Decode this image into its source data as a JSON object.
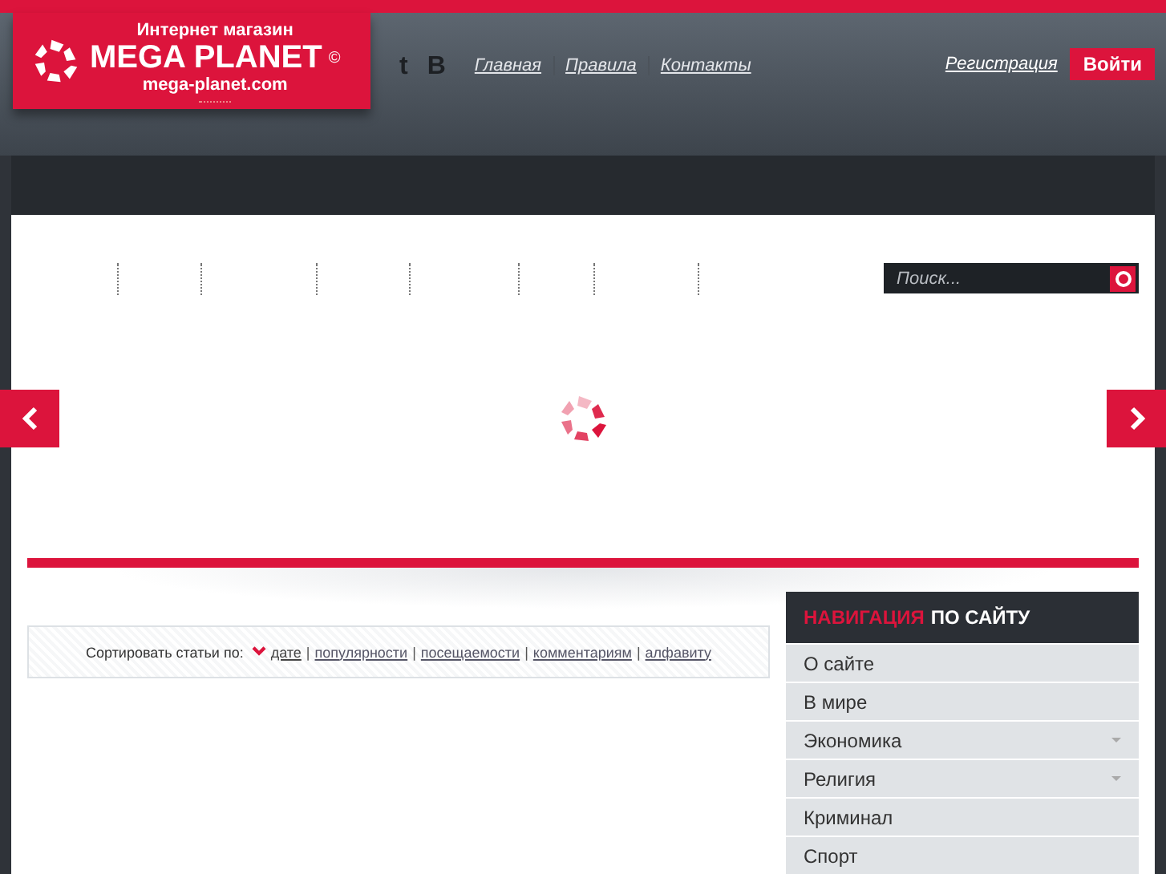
{
  "logo": {
    "tagline": "Интернет магазин",
    "name": "MEGA PLANET",
    "mark": "©",
    "domain": "mega-planet.com"
  },
  "social_icons": [
    "t",
    "B"
  ],
  "top_links": [
    "Главная",
    "Правила",
    "Контакты"
  ],
  "account": {
    "register": "Регистрация",
    "login": "Войти"
  },
  "search": {
    "placeholder": "Поиск..."
  },
  "sort": {
    "label": "Сортировать статьи по:",
    "separator": "|",
    "options": [
      {
        "label": "дате",
        "selected": true
      },
      {
        "label": "популярности",
        "selected": false
      },
      {
        "label": "посещаемости",
        "selected": false
      },
      {
        "label": "комментариям",
        "selected": false
      },
      {
        "label": "алфавиту",
        "selected": false
      }
    ]
  },
  "sidebar": {
    "title_accent": "НАВИГАЦИЯ",
    "title_rest": "ПО САЙТУ",
    "items": [
      {
        "label": "О сайте",
        "expandable": false
      },
      {
        "label": "В мире",
        "expandable": false
      },
      {
        "label": "Экономика",
        "expandable": true
      },
      {
        "label": "Религия",
        "expandable": true
      },
      {
        "label": "Криминал",
        "expandable": false
      },
      {
        "label": "Спорт",
        "expandable": false
      }
    ]
  }
}
